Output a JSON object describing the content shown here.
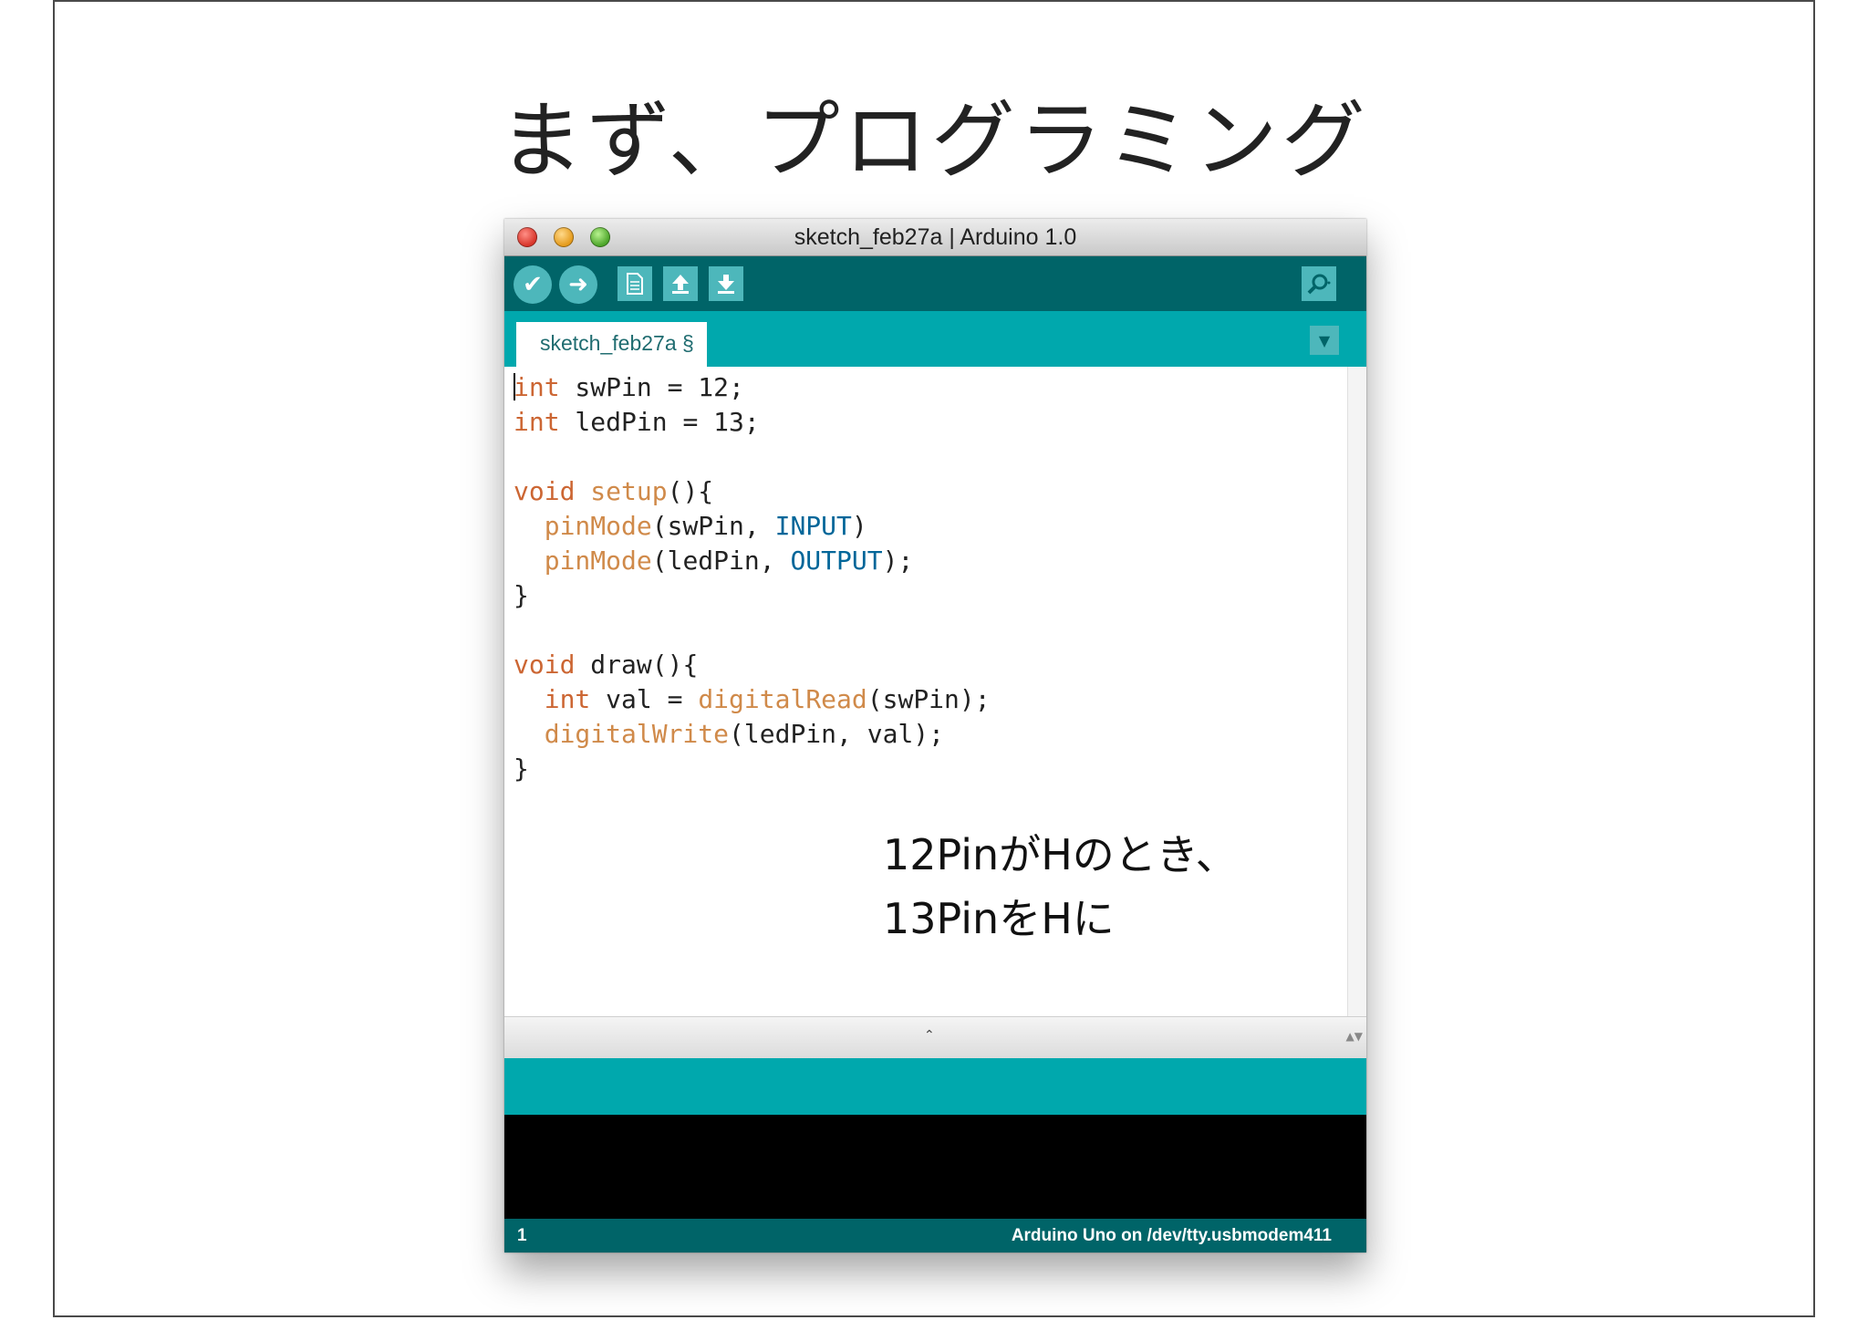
{
  "slide": {
    "title": "まず、プログラミング"
  },
  "window": {
    "title": "sketch_feb27a | Arduino 1.0"
  },
  "toolbar": {
    "verify_icon": "check-icon",
    "upload_icon": "arrow-right-icon",
    "new_icon": "document-icon",
    "open_icon": "arrow-up-icon",
    "save_icon": "arrow-down-icon",
    "serial_monitor_icon": "magnifier-icon"
  },
  "tabs": [
    {
      "label": "sketch_feb27a §"
    }
  ],
  "code": {
    "lines": [
      {
        "indent": "",
        "tokens": [
          {
            "t": "int",
            "c": "kw"
          },
          {
            "t": " swPin = 12;",
            "c": ""
          }
        ]
      },
      {
        "indent": "",
        "tokens": [
          {
            "t": "int",
            "c": "kw"
          },
          {
            "t": " ledPin = 13;",
            "c": ""
          }
        ]
      },
      {
        "indent": "",
        "tokens": []
      },
      {
        "indent": "",
        "tokens": [
          {
            "t": "void",
            "c": "kw"
          },
          {
            "t": " ",
            "c": ""
          },
          {
            "t": "setup",
            "c": "fn"
          },
          {
            "t": "(){",
            "c": ""
          }
        ]
      },
      {
        "indent": "  ",
        "tokens": [
          {
            "t": "pinMode",
            "c": "fn"
          },
          {
            "t": "(swPin, ",
            "c": ""
          },
          {
            "t": "INPUT",
            "c": "const"
          },
          {
            "t": ")",
            "c": ""
          }
        ]
      },
      {
        "indent": "  ",
        "tokens": [
          {
            "t": "pinMode",
            "c": "fn"
          },
          {
            "t": "(ledPin, ",
            "c": ""
          },
          {
            "t": "OUTPUT",
            "c": "const"
          },
          {
            "t": ");",
            "c": ""
          }
        ]
      },
      {
        "indent": "",
        "tokens": [
          {
            "t": "}",
            "c": ""
          }
        ]
      },
      {
        "indent": "",
        "tokens": []
      },
      {
        "indent": "",
        "tokens": [
          {
            "t": "void",
            "c": "kw"
          },
          {
            "t": " draw(){",
            "c": ""
          }
        ]
      },
      {
        "indent": "  ",
        "tokens": [
          {
            "t": "int",
            "c": "kw"
          },
          {
            "t": " val = ",
            "c": ""
          },
          {
            "t": "digitalRead",
            "c": "fn"
          },
          {
            "t": "(swPin);",
            "c": ""
          }
        ]
      },
      {
        "indent": "  ",
        "tokens": [
          {
            "t": "digitalWrite",
            "c": "fn"
          },
          {
            "t": "(ledPin, val);",
            "c": ""
          }
        ]
      },
      {
        "indent": "",
        "tokens": [
          {
            "t": "}",
            "c": ""
          }
        ]
      }
    ]
  },
  "annotation": {
    "line1": "12PinがHのとき、",
    "line2": "13PinをHに"
  },
  "footer": {
    "line_number": "1",
    "board": "Arduino Uno on /dev/tty.usbmodem411"
  },
  "colors": {
    "toolbar": "#006468",
    "tabbar": "#00a8ad",
    "keyword": "#cc6633",
    "constant": "#006699"
  }
}
